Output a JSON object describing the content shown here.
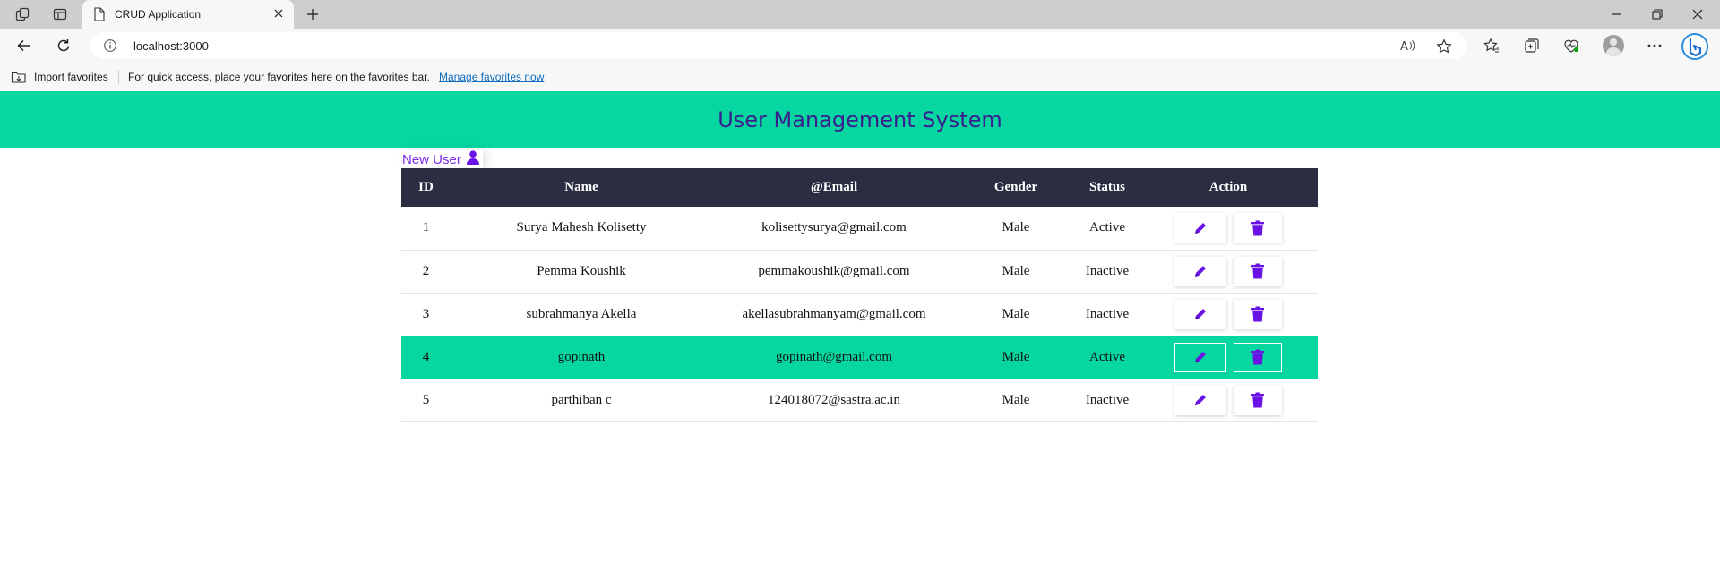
{
  "browser": {
    "tab_title": "CRUD Application",
    "url": "localhost:3000",
    "favorites_bar": {
      "import_label": "Import favorites",
      "message": "For quick access, place your favorites here on the favorites bar.",
      "manage_link": "Manage favorites now"
    }
  },
  "app": {
    "title": "User Management System",
    "new_user_label": "New User",
    "accent_color": "#06d6a0",
    "header_dark": "#2b2d42",
    "icon_color": "#6a11e6"
  },
  "table": {
    "columns": [
      "ID",
      "Name",
      "@Email",
      "Gender",
      "Status",
      "Action"
    ],
    "rows": [
      {
        "id": "1",
        "name": "Surya Mahesh Kolisetty",
        "email": "kolisettysurya@gmail.com",
        "gender": "Male",
        "status": "Active"
      },
      {
        "id": "2",
        "name": "Pemma Koushik",
        "email": "pemmakoushik@gmail.com",
        "gender": "Male",
        "status": "Inactive"
      },
      {
        "id": "3",
        "name": "subrahmanya Akella",
        "email": "akellasubrahmanyam@gmail.com",
        "gender": "Male",
        "status": "Inactive"
      },
      {
        "id": "4",
        "name": "gopinath",
        "email": "gopinath@gmail.com",
        "gender": "Male",
        "status": "Active"
      },
      {
        "id": "5",
        "name": "parthiban c",
        "email": "124018072@sastra.ac.in",
        "gender": "Male",
        "status": "Inactive"
      }
    ],
    "highlighted_row": 3,
    "action_icons": [
      "pencil-icon",
      "trash-icon"
    ]
  }
}
